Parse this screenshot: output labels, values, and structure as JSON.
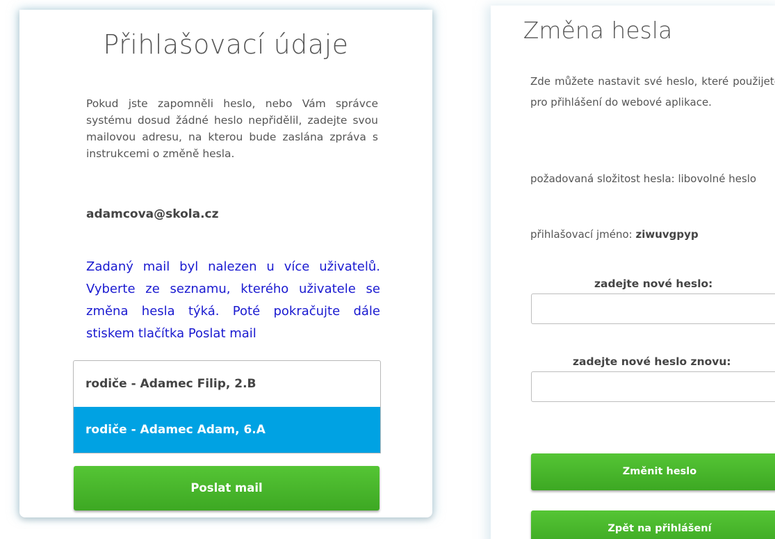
{
  "left_panel": {
    "title": "Přihlašovací údaje",
    "intro": "Pokud jste zapomněli heslo, nebo Vám správce systému dosud žádné heslo nepřidělil, zadejte svou mailovou adresu, na kterou bude zaslána zpráva s instrukcemi o změně hesla.",
    "email": "adamcova@skola.cz",
    "notice": "Zadaný mail byl nalezen u více uživatelů. Vyberte ze seznamu, kterého uživatele se změna hesla týká. Poté pokračujte dále stiskem tlačítka Poslat mail",
    "users": [
      {
        "label": "rodiče - Adamec Filip, 2.B",
        "selected": false
      },
      {
        "label": "rodiče - Adamec Adam, 6.A",
        "selected": true
      }
    ],
    "send_button": "Poslat mail"
  },
  "right_panel": {
    "title": "Změna hesla",
    "info": "Zde můžete nastavit své heslo, které použijete pro přihlášení do webové aplikace.",
    "complexity": "požadovaná složitost hesla: libovolné heslo",
    "login_label": "přihlašovací jméno:",
    "login_value": "ziwuvgpyp",
    "new_password_label": "zadejte nové heslo:",
    "repeat_password_label": "zadejte nové heslo znovu:",
    "new_password_value": "",
    "repeat_password_value": "",
    "change_button": "Změnit heslo",
    "back_button": "Zpět na přihlášení"
  },
  "colors": {
    "selected_option": "#00a2e3",
    "button_green": "#4ab82c",
    "notice_text": "#1a1ad0"
  }
}
